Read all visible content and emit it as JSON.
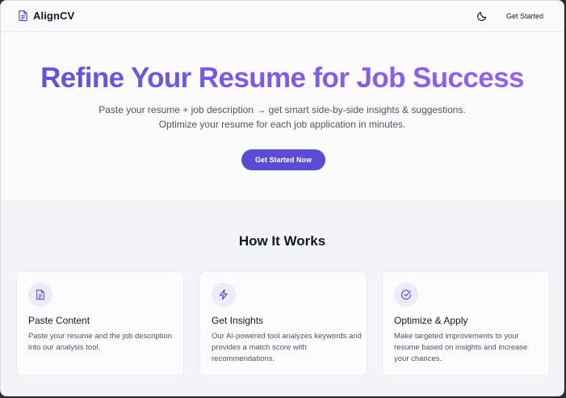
{
  "header": {
    "brand": "AlignCV",
    "brand_icon": "document-icon",
    "theme_icon": "moon-icon",
    "cta_label": "Get Started"
  },
  "hero": {
    "title": "Refine Your Resume for Job Success",
    "subtitle_line1": "Paste your resume + job description → get smart side-by-side insights & suggestions.",
    "subtitle_line2": "Optimize your resume for each job application in minutes.",
    "cta_label": "Get Started Now",
    "gradient_colors": [
      "#5b4fdc",
      "#9a64ea"
    ]
  },
  "how_it_works": {
    "title": "How It Works",
    "cards": [
      {
        "icon": "document-icon",
        "title": "Paste Content",
        "description": "Paste your resume and the job description into our analysis tool."
      },
      {
        "icon": "lightning-icon",
        "title": "Get Insights",
        "description": "Our AI-powered tool analyzes keywords and provides a match score with recommendations."
      },
      {
        "icon": "check-circle-icon",
        "title": "Optimize & Apply",
        "description": "Make targeted improvements to your resume based on insights and increase your chances."
      }
    ]
  },
  "colors": {
    "accent": "#5b4cd6",
    "icon_bg": "#ecebfa",
    "text_dark": "#111827",
    "text_muted": "#4b5563"
  }
}
